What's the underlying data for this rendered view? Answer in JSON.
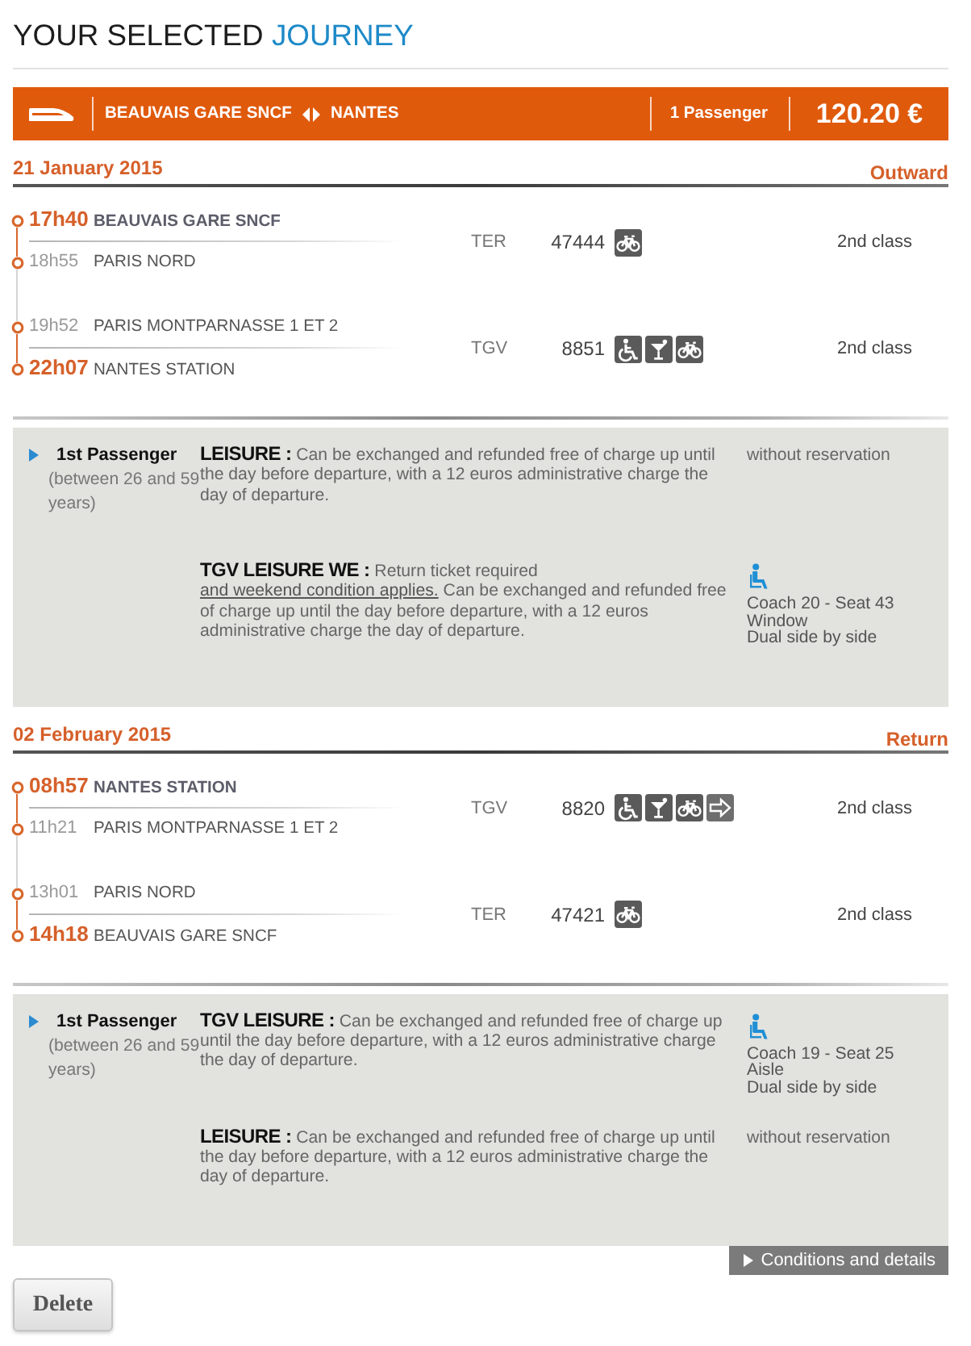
{
  "title": {
    "text": "YOUR SELECTED",
    "highlight": "JOURNEY"
  },
  "summary": {
    "origin": "BEAUVAIS GARE SNCF",
    "destination": "NANTES",
    "passengers": "1 Passenger",
    "price": "120.20 €"
  },
  "journeys": [
    {
      "date": "21 January 2015",
      "direction": "Outward",
      "segments": [
        {
          "stops": [
            {
              "time": "17h40",
              "station": "BEAUVAIS GARE SNCF",
              "kind": "origin"
            },
            {
              "time": "18h55",
              "station": "PARIS NORD",
              "kind": "connection"
            }
          ],
          "train_type": "TER",
          "train_number": "47444",
          "services": [
            {
              "kind": "bike"
            }
          ],
          "class": "2nd class"
        },
        {
          "stops": [
            {
              "time": "19h52",
              "station": "PARIS MONTPARNASSE 1 ET 2",
              "kind": "connection"
            },
            {
              "time": "22h07",
              "station": "NANTES STATION",
              "kind": "destination"
            }
          ],
          "train_type": "TGV",
          "train_number": "8851",
          "services": [
            {
              "kind": "wheelchair"
            },
            {
              "kind": "bar"
            },
            {
              "kind": "bike"
            }
          ],
          "class": "2nd class"
        }
      ],
      "passengers": [
        {
          "label": "1st Passenger",
          "age": "(between 26 and 59 years)",
          "fares": [
            {
              "name": "LEISURE :",
              "conditions": [
                {
                  "kind": "text",
                  "text": "Can be exchanged and refunded free of charge up until the day before departure, with a 12 euros administrative charge the day of departure."
                }
              ],
              "seat": {
                "kind": "none",
                "text": "without reservation"
              }
            },
            {
              "name": "TGV LEISURE WE :",
              "conditions": [
                {
                  "kind": "text",
                  "text": "Return ticket required"
                },
                {
                  "kind": "link",
                  "text": "and weekend condition applies."
                },
                {
                  "kind": "text",
                  "text": "Can be exchanged and refunded free of charge up until the day before departure, with a 12 euros administrative charge the day of departure."
                }
              ],
              "seat": {
                "kind": "assigned",
                "lines": [
                  "Coach 20 - Seat 43",
                  "Window",
                  "Dual side by side"
                ]
              }
            }
          ]
        }
      ]
    },
    {
      "date": "02 February 2015",
      "direction": "Return",
      "segments": [
        {
          "stops": [
            {
              "time": "08h57",
              "station": "NANTES STATION",
              "kind": "origin"
            },
            {
              "time": "11h21",
              "station": "PARIS MONTPARNASSE 1 ET 2",
              "kind": "connection"
            }
          ],
          "train_type": "TGV",
          "train_number": "8820",
          "services": [
            {
              "kind": "wheelchair"
            },
            {
              "kind": "bar"
            },
            {
              "kind": "bike"
            },
            {
              "kind": "arrow"
            }
          ],
          "class": "2nd class"
        },
        {
          "stops": [
            {
              "time": "13h01",
              "station": "PARIS NORD",
              "kind": "connection"
            },
            {
              "time": "14h18",
              "station": "BEAUVAIS GARE SNCF",
              "kind": "destination"
            }
          ],
          "train_type": "TER",
          "train_number": "47421",
          "services": [
            {
              "kind": "bike"
            }
          ],
          "class": "2nd class"
        }
      ],
      "passengers": [
        {
          "label": "1st Passenger",
          "age": "(between 26 and 59 years)",
          "fares": [
            {
              "name": "TGV LEISURE :",
              "conditions": [
                {
                  "kind": "text",
                  "text": "Can be exchanged and refunded free of charge up until the day before departure, with a 12 euros administrative charge the day of departure."
                }
              ],
              "seat": {
                "kind": "assigned",
                "lines": [
                  "Coach 19 - Seat 25",
                  "Aisle",
                  "Dual side by side"
                ]
              }
            },
            {
              "name": "LEISURE :",
              "conditions": [
                {
                  "kind": "text",
                  "text": "Can be exchanged and refunded free of charge up until the day before departure, with a 12 euros administrative charge the day of departure."
                }
              ],
              "seat": {
                "kind": "none",
                "text": "without reservation"
              }
            }
          ]
        }
      ]
    }
  ],
  "conditions_button": "Conditions and details",
  "delete_button": "Delete"
}
